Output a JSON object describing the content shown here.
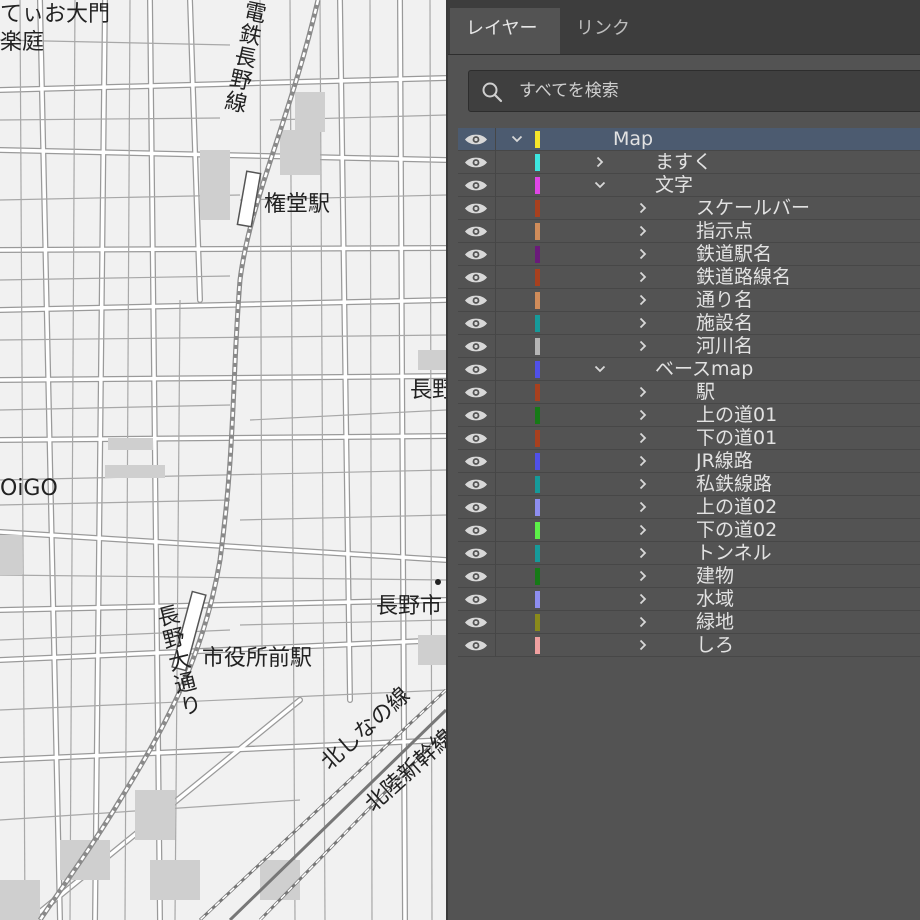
{
  "map": {
    "labels": {
      "top_left_1": "てぃお大門",
      "top_left_2": "楽庭",
      "railway_name": "電鉄長野線",
      "station_gondo": "権堂駅",
      "nagano_partial": "長野",
      "oigo": "OiGO",
      "avenue": "長野大通り",
      "station_shiyakusho": "市役所前駅",
      "nagano_city_partial": "長野市",
      "kitashinano": "北しなの線",
      "hokuriku": "北陸新幹線"
    }
  },
  "panel": {
    "tabs": [
      {
        "label": "レイヤー",
        "active": true
      },
      {
        "label": "リンク",
        "active": false
      }
    ],
    "search": {
      "placeholder": "すべてを検索",
      "icon": "search-icon"
    },
    "layers": [
      {
        "name": "Map",
        "color": "#f5e52a",
        "depth": 0,
        "expanded": true,
        "selected": true
      },
      {
        "name": "ますく",
        "color": "#3de6e0",
        "depth": 1,
        "expanded": false
      },
      {
        "name": "文字",
        "color": "#e046e6",
        "depth": 1,
        "expanded": true
      },
      {
        "name": "スケールバー",
        "color": "#a8401e",
        "depth": 2,
        "expanded": false
      },
      {
        "name": "指示点",
        "color": "#d08c5a",
        "depth": 2,
        "expanded": false
      },
      {
        "name": "鉄道駅名",
        "color": "#6a1a7a",
        "depth": 2,
        "expanded": false
      },
      {
        "name": "鉄道路線名",
        "color": "#a8401e",
        "depth": 2,
        "expanded": false
      },
      {
        "name": "通り名",
        "color": "#d08c5a",
        "depth": 2,
        "expanded": false
      },
      {
        "name": "施設名",
        "color": "#159a9a",
        "depth": 2,
        "expanded": false
      },
      {
        "name": "河川名",
        "color": "#b5b5b5",
        "depth": 2,
        "expanded": false
      },
      {
        "name": "ベースmap",
        "color": "#5050e8",
        "depth": 1,
        "expanded": true
      },
      {
        "name": "駅",
        "color": "#a8401e",
        "depth": 2,
        "expanded": false
      },
      {
        "name": "上の道01",
        "color": "#167a16",
        "depth": 2,
        "expanded": false
      },
      {
        "name": "下の道01",
        "color": "#a8401e",
        "depth": 2,
        "expanded": false
      },
      {
        "name": "JR線路",
        "color": "#5050e8",
        "depth": 2,
        "expanded": false
      },
      {
        "name": "私鉄線路",
        "color": "#159a9a",
        "depth": 2,
        "expanded": false
      },
      {
        "name": "上の道02",
        "color": "#8e8ef0",
        "depth": 2,
        "expanded": false
      },
      {
        "name": "下の道02",
        "color": "#5cf048",
        "depth": 2,
        "expanded": false
      },
      {
        "name": "トンネル",
        "color": "#159a9a",
        "depth": 2,
        "expanded": false
      },
      {
        "name": "建物",
        "color": "#167a16",
        "depth": 2,
        "expanded": false
      },
      {
        "name": "水域",
        "color": "#8e8ef0",
        "depth": 2,
        "expanded": false
      },
      {
        "name": "緑地",
        "color": "#8a8a1a",
        "depth": 2,
        "expanded": false
      },
      {
        "name": "しろ",
        "color": "#f0a0a0",
        "depth": 2,
        "expanded": false
      }
    ]
  }
}
